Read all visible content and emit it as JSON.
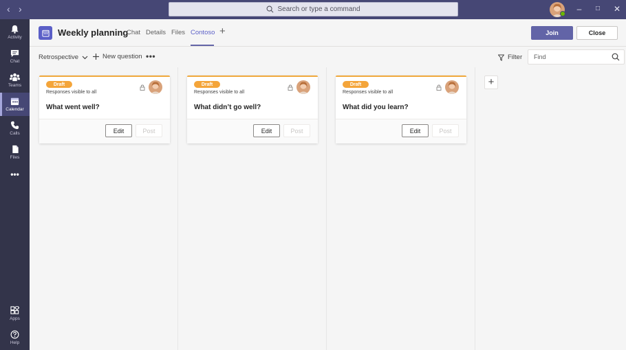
{
  "titlebar": {
    "back_icon": "chevron-left-icon",
    "forward_icon": "chevron-right-icon",
    "search_placeholder": "Search or type a command",
    "window_controls": [
      "minimize-icon",
      "maximize-icon",
      "close-icon"
    ]
  },
  "rail": {
    "items": [
      {
        "label": "Activity",
        "icon": "bell-icon"
      },
      {
        "label": "Chat",
        "icon": "chat-icon"
      },
      {
        "label": "Teams",
        "icon": "teams-icon"
      },
      {
        "label": "Calendar",
        "icon": "calendar-icon",
        "active": true
      },
      {
        "label": "Calls",
        "icon": "phone-icon"
      },
      {
        "label": "Files",
        "icon": "file-icon"
      }
    ],
    "more_icon": "more-icon",
    "bottom_items": [
      {
        "label": "Apps",
        "icon": "apps-icon"
      },
      {
        "label": "Help",
        "icon": "help-icon"
      }
    ]
  },
  "header": {
    "title": "Weekly planning",
    "tabs": [
      {
        "label": "Chat"
      },
      {
        "label": "Details"
      },
      {
        "label": "Files"
      },
      {
        "label": "Contoso",
        "active": true
      }
    ],
    "join_label": "Join",
    "close_label": "Close"
  },
  "toolbar": {
    "view_label": "Retrospective",
    "new_question_label": "New question",
    "more_label": "•••",
    "filter_label": "Filter",
    "find_placeholder": "Find"
  },
  "cards": [
    {
      "status": "Draft",
      "visibility": "Responses visible to all",
      "question": "What went well?",
      "edit_label": "Edit",
      "post_label": "Post"
    },
    {
      "status": "Draft",
      "visibility": "Responses visible to all",
      "question": "What didn’t go well?",
      "edit_label": "Edit",
      "post_label": "Post"
    },
    {
      "status": "Draft",
      "visibility": "Responses visible to all",
      "question": "What did you learn?",
      "edit_label": "Edit",
      "post_label": "Post"
    }
  ],
  "colors": {
    "titlebar": "#464775",
    "rail": "#33344a",
    "accent": "#6264a7",
    "draft_badge": "#f4a53a",
    "presence": "#6bb700"
  }
}
